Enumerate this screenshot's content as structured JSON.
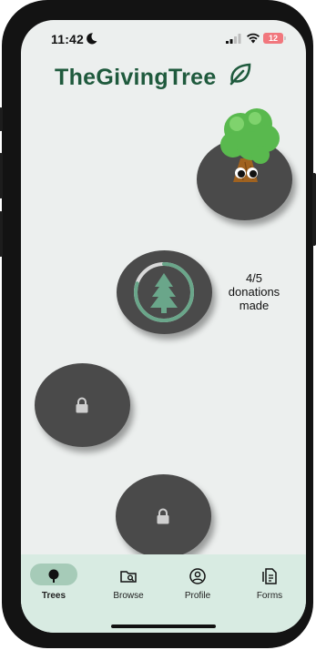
{
  "status_bar": {
    "time": "11:42",
    "battery": "12",
    "icons": [
      "moon-icon",
      "signal-icon",
      "wifi-icon",
      "battery-icon"
    ]
  },
  "app": {
    "brand": "TheGivingTree",
    "brand_icon": "leaf-icon",
    "brand_color": "#1f5a3d"
  },
  "path": {
    "nodes": [
      {
        "state": "complete",
        "icon": "tree-character"
      },
      {
        "state": "in-progress",
        "icon": "pine-tree-icon",
        "progress": 0.8
      },
      {
        "state": "locked",
        "icon": "lock-icon"
      },
      {
        "state": "locked",
        "icon": "lock-icon"
      }
    ],
    "progress_label_line1": "4/5",
    "progress_label_line2": "donations",
    "progress_label_line3": "made",
    "accent_color": "#6aa68a",
    "node_color": "#4a4a4a"
  },
  "bottom_nav": {
    "background": "#d8ebe2",
    "items": [
      {
        "label": "Trees",
        "icon": "tree-icon",
        "active": true
      },
      {
        "label": "Browse",
        "icon": "folder-search-icon",
        "active": false
      },
      {
        "label": "Profile",
        "icon": "profile-icon",
        "active": false
      },
      {
        "label": "Forms",
        "icon": "document-icon",
        "active": false
      }
    ]
  }
}
